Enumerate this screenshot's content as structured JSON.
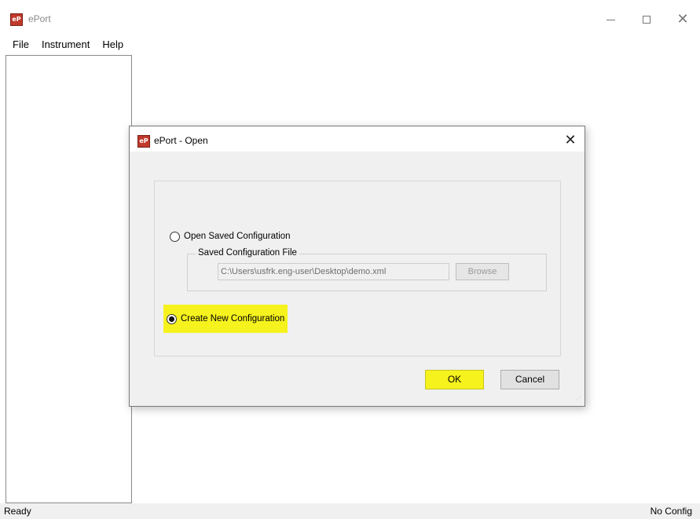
{
  "app": {
    "title": "ePort",
    "icon_text": "eP",
    "icon_color": "#c0392b"
  },
  "window_controls": {
    "minimize_icon": "minimize-icon",
    "maximize_icon": "maximize-icon",
    "close_icon": "close-icon",
    "close_glyph": "✕"
  },
  "menu": {
    "items": [
      "File",
      "Instrument",
      "Help"
    ]
  },
  "statusbar": {
    "left": "Ready",
    "right": "No Config"
  },
  "dialog": {
    "title": "ePort - Open",
    "icon_text": "eP",
    "close_glyph": "✕",
    "open_saved_label": "Open Saved Configuration",
    "open_saved_selected": false,
    "saved_file_legend": "Saved Configuration File",
    "saved_file_path": "C:\\Users\\usfrk.eng-user\\Desktop\\demo.xml",
    "browse_label": "Browse",
    "create_new_label": "Create New Configuration",
    "create_new_selected": true,
    "ok_label": "OK",
    "cancel_label": "Cancel",
    "highlight_color": "#f6f21e"
  }
}
